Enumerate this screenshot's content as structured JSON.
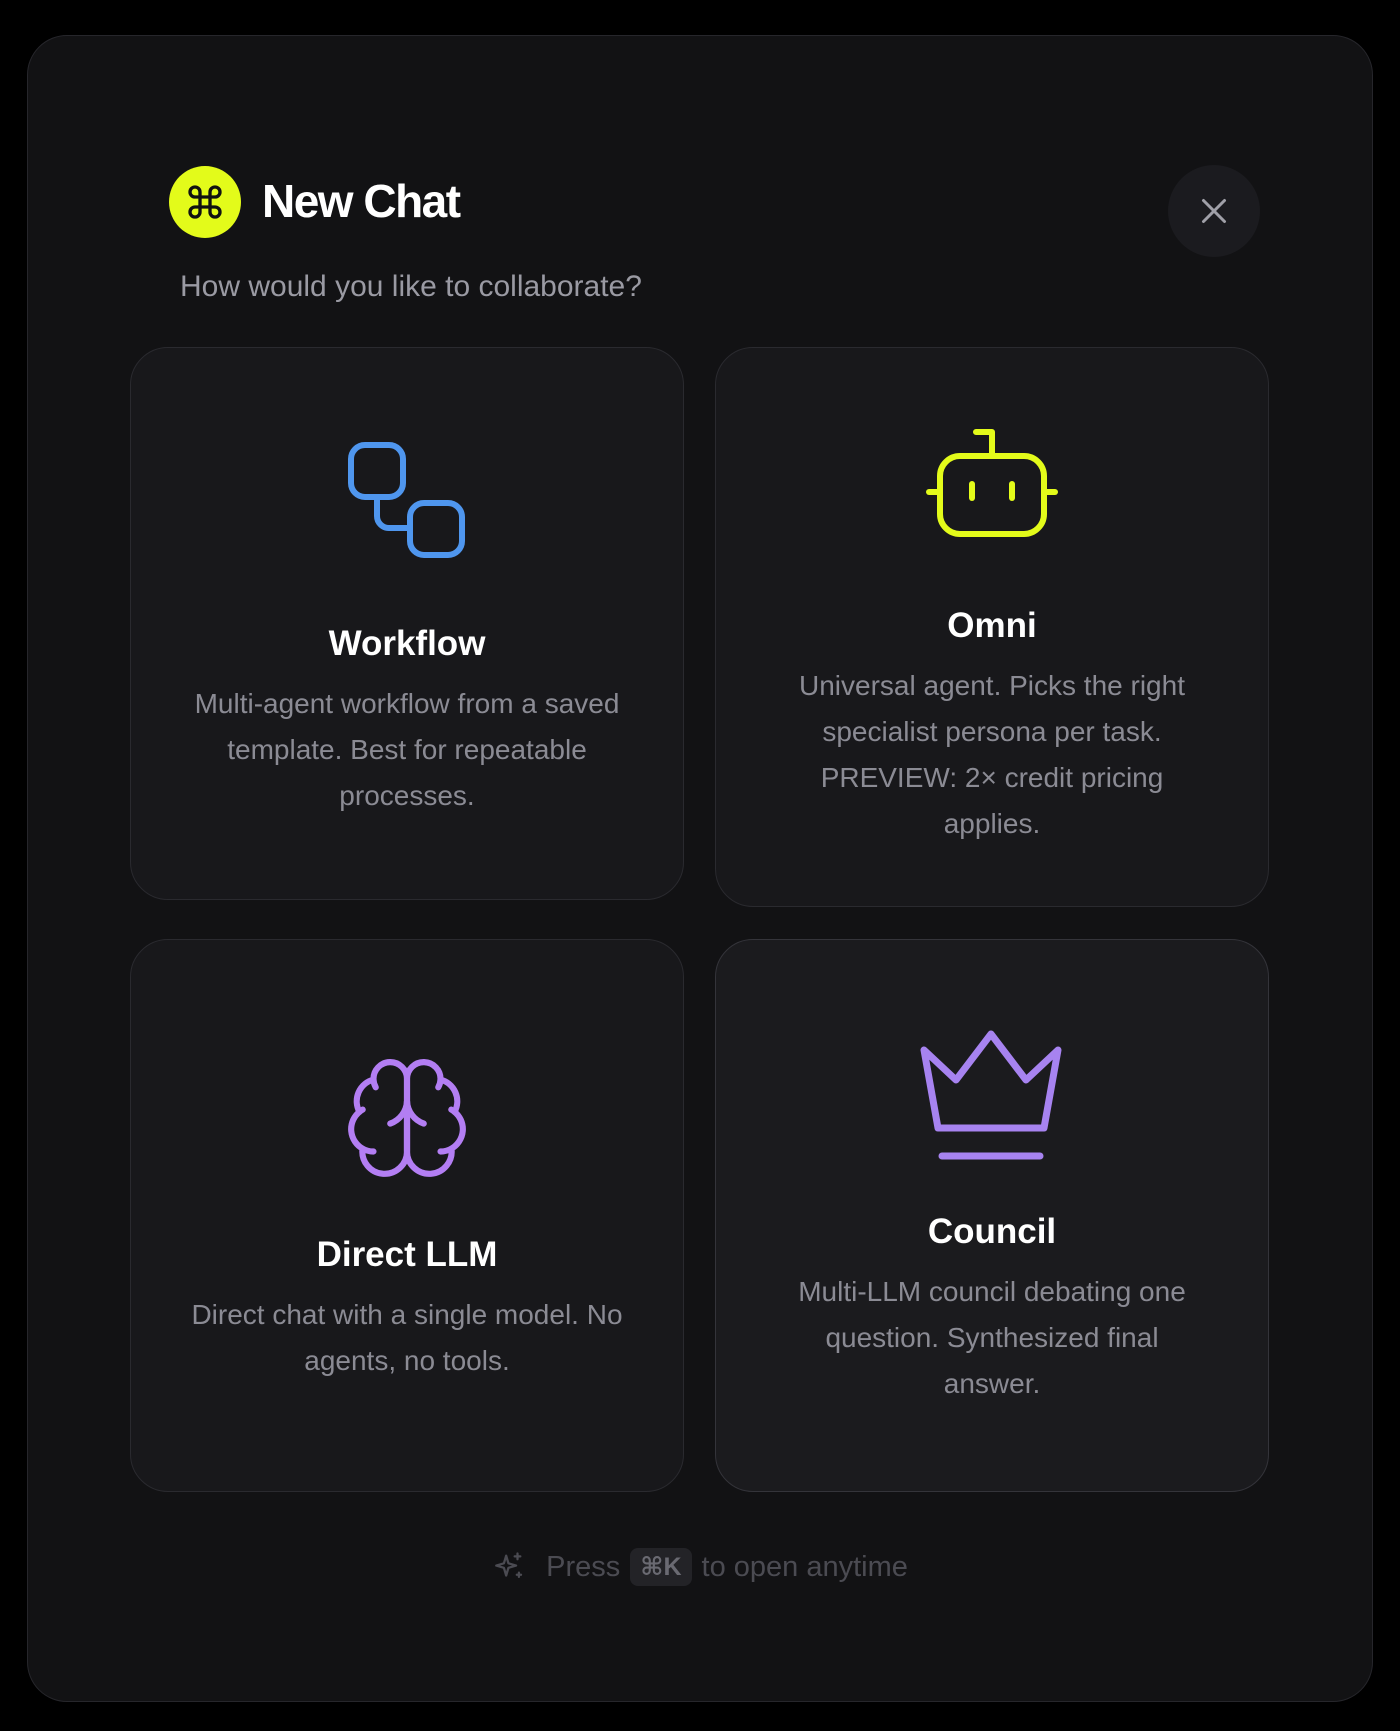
{
  "dialog": {
    "title": "New Chat",
    "subtitle": "How would you like to collaborate?",
    "logo_icon": "command-icon",
    "close_icon": "close-icon"
  },
  "options": [
    {
      "id": "workflow",
      "title": "Workflow",
      "description": "Multi-agent workflow from a saved template. Best for repeatable processes.",
      "icon": "workflow-icon",
      "icon_color": "#4f96ee"
    },
    {
      "id": "omni",
      "title": "Omni",
      "description": "Universal agent. Picks the right specialist persona per task. PREVIEW: 2× credit pricing applies.",
      "icon": "robot-icon",
      "icon_color": "#e3fb1a"
    },
    {
      "id": "direct-llm",
      "title": "Direct LLM",
      "description": "Direct chat with a single model. No agents, no tools.",
      "icon": "brain-icon",
      "icon_color": "#b37ef3"
    },
    {
      "id": "council",
      "title": "Council",
      "description": "Multi-LLM council debating one question. Synthesized final answer.",
      "icon": "crown-icon",
      "icon_color": "#a783f0"
    }
  ],
  "footer": {
    "prefix": "Press",
    "shortcut": "⌘K",
    "suffix": "to open anytime",
    "icon": "sparkle-icon"
  },
  "colors": {
    "accent": "#e3fb1a",
    "background": "#000000",
    "modal": "#121214",
    "card": "#18181b"
  }
}
